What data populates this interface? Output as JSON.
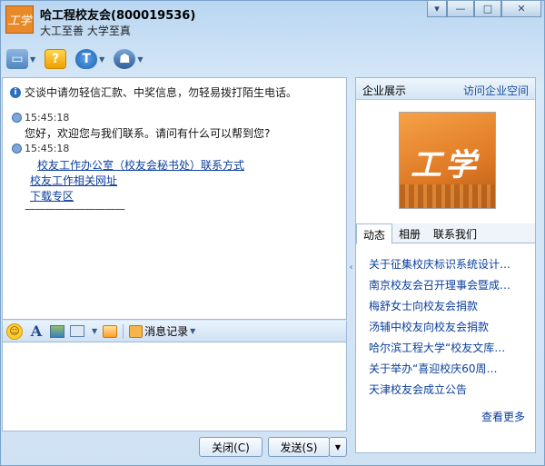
{
  "window": {
    "title": "哈工程校友会(800019536)",
    "signature": "大工至善 大学至真",
    "avatar_text": "工学",
    "controls": {
      "minimize": "—",
      "maximize": "□",
      "close": "✕",
      "settings": "▾"
    }
  },
  "toolbar": {
    "items": [
      {
        "icon": "folder-icon",
        "glyph": "▭"
      },
      {
        "icon": "help-icon",
        "glyph": "?"
      },
      {
        "icon": "shield-icon",
        "glyph": "T"
      },
      {
        "icon": "police-icon",
        "glyph": "☗"
      }
    ]
  },
  "chat": {
    "notice": "交谈中请勿轻信汇款、中奖信息，勿轻易拨打陌生电话。",
    "messages": [
      {
        "time": "15:45:18",
        "text": "您好，欢迎您与我们联系。请问有什么可以帮到您?"
      },
      {
        "time": "15:45:18"
      }
    ],
    "links": [
      "校友工作办公室（校友会秘书处）联系方式",
      "校友工作相关网址",
      "下载专区"
    ],
    "divider": "——————————"
  },
  "format_bar": {
    "record_label": "消息记录"
  },
  "input": {
    "value": ""
  },
  "buttons": {
    "close": "关闭(C)",
    "send": "发送(S)",
    "send_dropdown": "▼"
  },
  "side": {
    "title": "企业展示",
    "visit": "访问企业空间",
    "logo_text": "工学",
    "tabs": [
      "动态",
      "相册",
      "联系我们"
    ],
    "news": [
      "关于征集校庆标识系统设计…",
      "南京校友会召开理事会暨成…",
      "梅舒女士向校友会捐款",
      "汤辅中校友向校友会捐款",
      "哈尔滨工程大学“校友文库…",
      "关于举办“喜迎校庆60周…",
      "天津校友会成立公告"
    ],
    "more": "查看更多"
  },
  "splitter": {
    "glyph": "‹"
  }
}
